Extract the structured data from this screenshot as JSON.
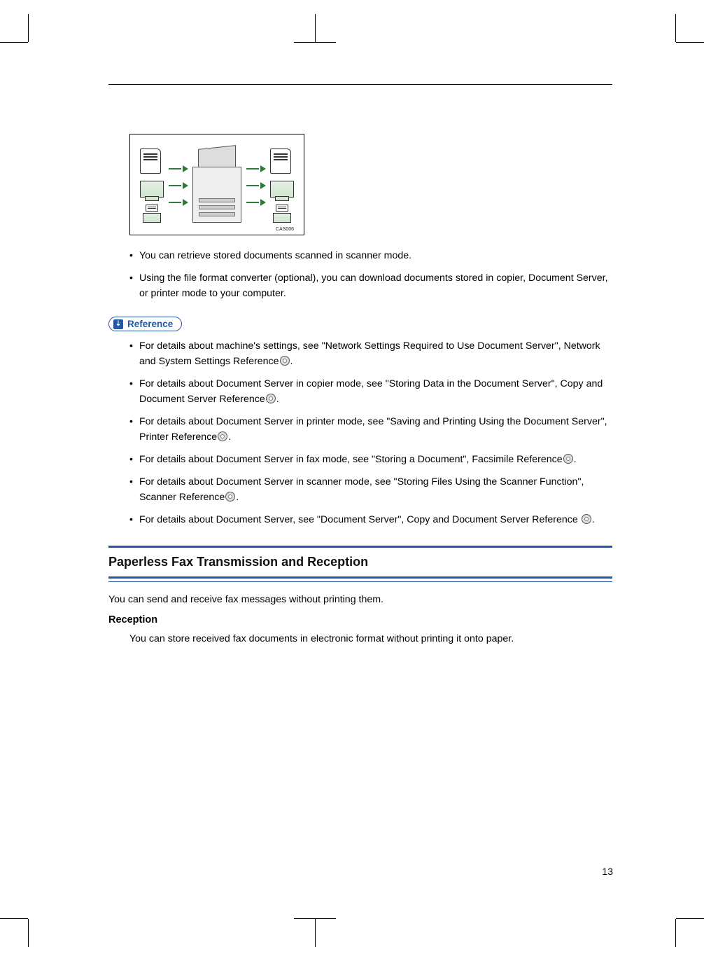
{
  "figure": {
    "cas_label": "CAS006"
  },
  "intro_bullets": [
    "You can retrieve stored documents scanned in scanner mode.",
    "Using the file format converter (optional), you can download documents stored in copier, Document Server, or printer mode to your computer."
  ],
  "reference": {
    "badge_label": "Reference",
    "bullets": [
      "For details about machine's settings, see \"Network Settings Required to Use Document Server\", Network and System Settings Reference",
      "For details about Document Server in copier mode, see \"Storing Data in the Document Server\", Copy and Document Server Reference",
      "For details about Document Server in printer mode, see \"Saving and Printing Using the Document Server\", Printer Reference",
      "For details about Document Server in fax mode, see \"Storing a Document\", Facsimile Reference",
      "For details about Document Server in scanner mode, see \"Storing Files Using the Scanner Function\", Scanner Reference",
      "For details about Document Server, see \"Document Server\", Copy and Document Server Reference"
    ]
  },
  "section": {
    "title": "Paperless Fax Transmission and Reception",
    "para": "You can send and receive fax messages without printing them.",
    "subheading": "Reception",
    "subpara": "You can store received fax documents in electronic format without printing it onto paper."
  },
  "page_number": "13"
}
